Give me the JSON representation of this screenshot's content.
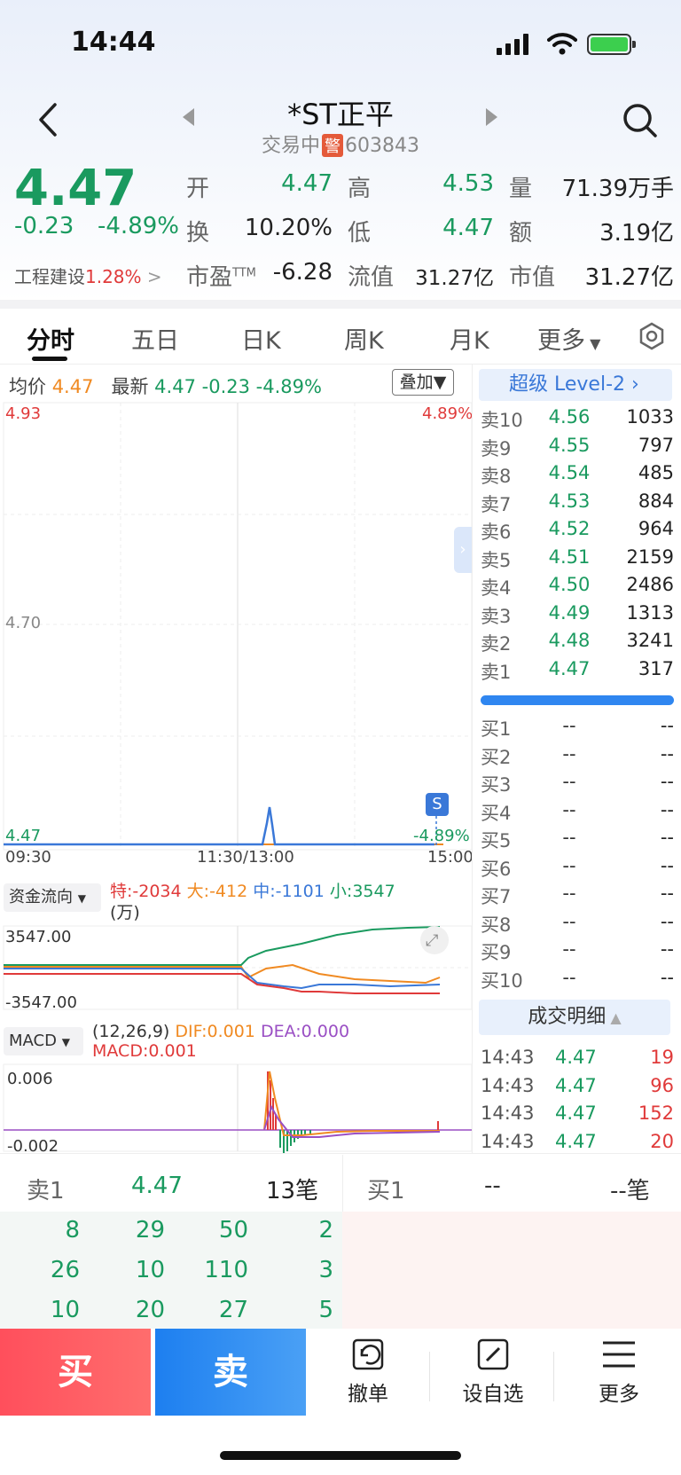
{
  "status": {
    "time": "14:44"
  },
  "header": {
    "title": "*ST正平",
    "status": "交易中",
    "warn": "警",
    "code": "603843"
  },
  "quote": {
    "price": "4.47",
    "change": "-0.23",
    "change_pct": "-4.89%",
    "sector_name": "工程建设",
    "sector_pct": "1.28%",
    "open_label": "开",
    "open": "4.47",
    "high_label": "高",
    "high": "4.53",
    "volume_label": "量",
    "volume": "71.39万手",
    "turnover_label": "换",
    "turnover": "10.20%",
    "low_label": "低",
    "low": "4.47",
    "amount_label": "额",
    "amount": "3.19亿",
    "pe_label": "市盈",
    "pe_sup": "TTM",
    "pe": "-6.28",
    "float_cap_label": "流值",
    "float_cap": "31.27亿",
    "mkt_cap_label": "市值",
    "mkt_cap": "31.27亿"
  },
  "tabs": [
    {
      "label": "分时"
    },
    {
      "label": "五日"
    },
    {
      "label": "日K"
    },
    {
      "label": "周K"
    },
    {
      "label": "月K"
    },
    {
      "label": "更多"
    }
  ],
  "intraday": {
    "avg_label": "均价",
    "avg": "4.47",
    "latest_label": "最新",
    "latest": "4.47",
    "latest_chg": "-0.23",
    "latest_pct": "-4.89%",
    "overlay": "叠加",
    "y_top": "4.93",
    "y_mid": "4.70",
    "y_bottom": "4.47",
    "pct_top": "4.89%",
    "pct_bottom": "-4.89%",
    "t_open": "09:30",
    "t_mid": "11:30/13:00",
    "t_close": "15:00",
    "marker": "S"
  },
  "money_flow": {
    "select": "资金流向",
    "te": "特:-2034",
    "da": "大:-412",
    "zhong": "中:-1101",
    "xiao": "小:3547",
    "unit": "(万)",
    "y_top": "3547.00",
    "y_bottom": "-3547.00"
  },
  "macd": {
    "select": "MACD",
    "params": "(12,26,9)",
    "dif": "DIF:0.001",
    "dea": "DEA:0.000",
    "macd": "MACD:0.001",
    "y_top": "0.006",
    "y_bottom": "-0.002"
  },
  "orderbook": {
    "header": "超级 Level-2",
    "asks": [
      {
        "label": "卖10",
        "price": "4.56",
        "vol": "1033"
      },
      {
        "label": "卖9",
        "price": "4.55",
        "vol": "797"
      },
      {
        "label": "卖8",
        "price": "4.54",
        "vol": "485"
      },
      {
        "label": "卖7",
        "price": "4.53",
        "vol": "884"
      },
      {
        "label": "卖6",
        "price": "4.52",
        "vol": "964"
      },
      {
        "label": "卖5",
        "price": "4.51",
        "vol": "2159"
      },
      {
        "label": "卖4",
        "price": "4.50",
        "vol": "2486"
      },
      {
        "label": "卖3",
        "price": "4.49",
        "vol": "1313"
      },
      {
        "label": "卖2",
        "price": "4.48",
        "vol": "3241"
      },
      {
        "label": "卖1",
        "price": "4.47",
        "vol": "317"
      }
    ],
    "bids": [
      {
        "label": "买1",
        "price": "--",
        "vol": "--"
      },
      {
        "label": "买2",
        "price": "--",
        "vol": "--"
      },
      {
        "label": "买3",
        "price": "--",
        "vol": "--"
      },
      {
        "label": "买4",
        "price": "--",
        "vol": "--"
      },
      {
        "label": "买5",
        "price": "--",
        "vol": "--"
      },
      {
        "label": "买6",
        "price": "--",
        "vol": "--"
      },
      {
        "label": "买7",
        "price": "--",
        "vol": "--"
      },
      {
        "label": "买8",
        "price": "--",
        "vol": "--"
      },
      {
        "label": "买9",
        "price": "--",
        "vol": "--"
      },
      {
        "label": "买10",
        "price": "--",
        "vol": "--"
      }
    ],
    "trades_header": "成交明细",
    "trades": [
      {
        "time": "14:43",
        "price": "4.47",
        "vol": "19"
      },
      {
        "time": "14:43",
        "price": "4.47",
        "vol": "96"
      },
      {
        "time": "14:43",
        "price": "4.47",
        "vol": "152"
      },
      {
        "time": "14:43",
        "price": "4.47",
        "vol": "20"
      }
    ]
  },
  "queue": {
    "sell_label": "卖1",
    "sell_price": "4.47",
    "sell_count": "13笔",
    "buy_label": "买1",
    "buy_price": "--",
    "buy_count": "--笔",
    "rows": [
      [
        "8",
        "29",
        "50",
        "2"
      ],
      [
        "26",
        "10",
        "110",
        "3"
      ],
      [
        "10",
        "20",
        "27",
        "5"
      ]
    ]
  },
  "actions": {
    "buy": "买",
    "sell": "卖",
    "cancel": "撤单",
    "watch": "设自选",
    "more": "更多"
  },
  "colors": {
    "up": "#e03a3a",
    "down": "#1a9a5f",
    "accent": "#2f86f0"
  }
}
